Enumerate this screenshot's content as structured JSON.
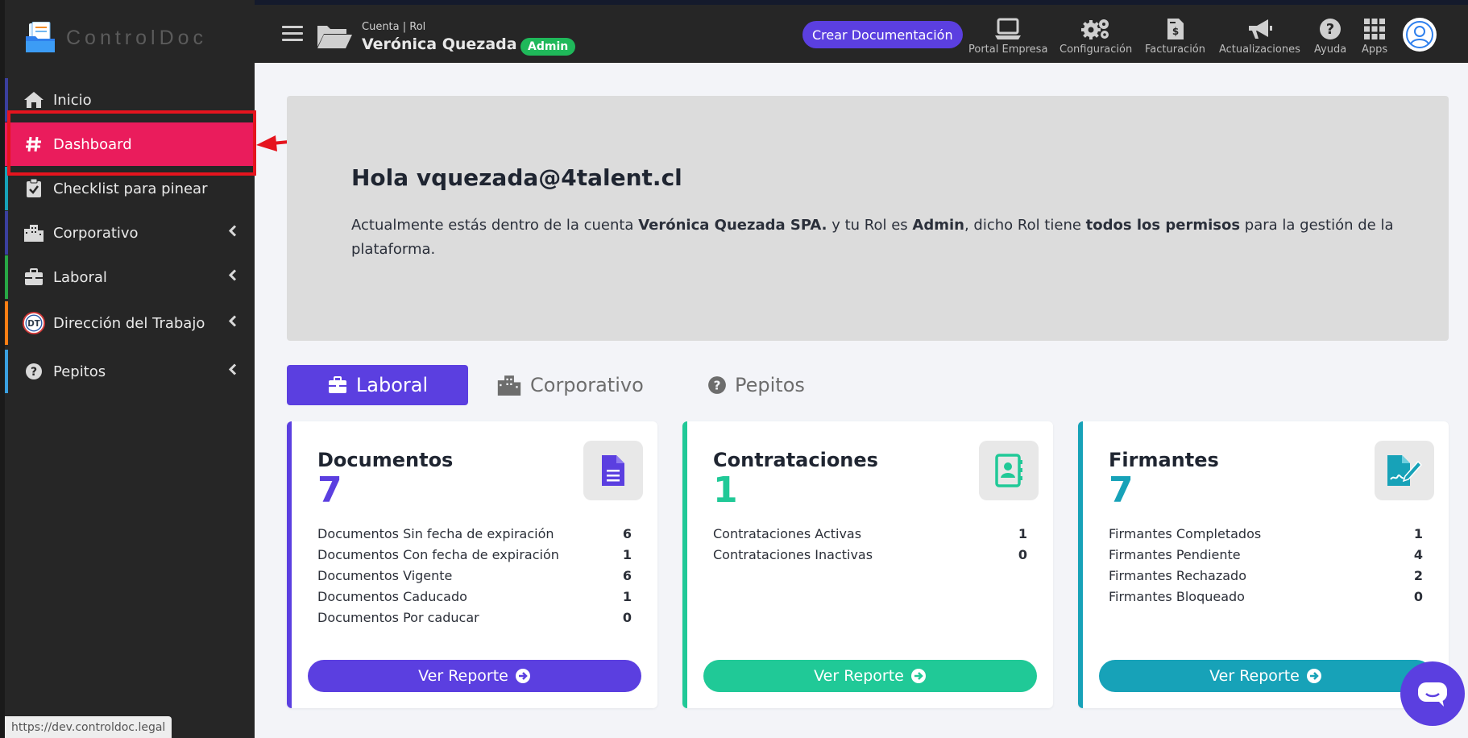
{
  "brand": {
    "name": "ControlDoc"
  },
  "sidebar": {
    "items": [
      {
        "label": "Inicio",
        "icon": "home-icon",
        "accent": "#3b3f9e"
      },
      {
        "label": "Dashboard",
        "icon": "hash-icon",
        "accent": "#ea1c5c"
      },
      {
        "label": "Checklist para pinear",
        "icon": "clipboard-check-icon",
        "accent": "#17a2b8"
      },
      {
        "label": "Corporativo",
        "icon": "building-icon",
        "accent": "#3b3f9e"
      },
      {
        "label": "Laboral",
        "icon": "briefcase-icon",
        "accent": "#28a745"
      },
      {
        "label": "Dirección del Trabajo",
        "icon": "dt-badge-icon",
        "accent": "#fd7e14"
      },
      {
        "label": "Pepitos",
        "icon": "question-circle-icon",
        "accent": "#3aa0e0"
      }
    ],
    "active_color": "#ea1c5c"
  },
  "topbar": {
    "account_label": "Cuenta | Rol",
    "account_name": "Verónica Quezada ...",
    "role_badge": "Admin",
    "create_button": "Crear Documentación",
    "items": [
      {
        "label": "Portal Empresa",
        "icon": "laptop-icon"
      },
      {
        "label": "Configuración",
        "icon": "gears-icon"
      },
      {
        "label": "Facturación",
        "icon": "invoice-icon"
      },
      {
        "label": "Actualizaciones",
        "icon": "megaphone-icon"
      },
      {
        "label": "Ayuda",
        "icon": "question-icon"
      },
      {
        "label": "Apps",
        "icon": "grid-icon"
      }
    ]
  },
  "greeting": {
    "title": "Hola vquezada@4talent.cl",
    "line_prefix": "Actualmente estás dentro de la cuenta ",
    "account": "Verónica Quezada SPA.",
    "line_mid": " y tu Rol es ",
    "role": "Admin",
    "line_mid2": ", dicho Rol tiene ",
    "permissions": "todos los permisos",
    "line_suffix": " para la gestión de la plataforma."
  },
  "tabs": [
    {
      "label": "Laboral",
      "icon": "briefcase-icon"
    },
    {
      "label": "Corporativo",
      "icon": "building-icon"
    },
    {
      "label": "Pepitos",
      "icon": "question-circle-icon"
    }
  ],
  "cards": [
    {
      "title": "Documentos",
      "count": "7",
      "color": "#5b3fe0",
      "icon": "document-icon",
      "rows": [
        {
          "label": "Documentos Sin fecha de expiración",
          "value": "6"
        },
        {
          "label": "Documentos Con fecha de expiración",
          "value": "1"
        },
        {
          "label": "Documentos Vigente",
          "value": "6"
        },
        {
          "label": "Documentos Caducado",
          "value": "1"
        },
        {
          "label": "Documentos Por caducar",
          "value": "0"
        }
      ],
      "button": "Ver Reporte"
    },
    {
      "title": "Contrataciones",
      "count": "1",
      "color": "#20c997",
      "icon": "address-book-icon",
      "rows": [
        {
          "label": "Contrataciones Activas",
          "value": "1"
        },
        {
          "label": "Contrataciones Inactivas",
          "value": "0"
        }
      ],
      "button": "Ver Reporte"
    },
    {
      "title": "Firmantes",
      "count": "7",
      "color": "#17a2b8",
      "icon": "signature-icon",
      "rows": [
        {
          "label": "Firmantes Completados",
          "value": "1"
        },
        {
          "label": "Firmantes Pendiente",
          "value": "4"
        },
        {
          "label": "Firmantes Rechazado",
          "value": "2"
        },
        {
          "label": "Firmantes Bloqueado",
          "value": "0"
        }
      ],
      "button": "Ver Reporte"
    }
  ],
  "status_url": "https://dev.controldoc.legal"
}
